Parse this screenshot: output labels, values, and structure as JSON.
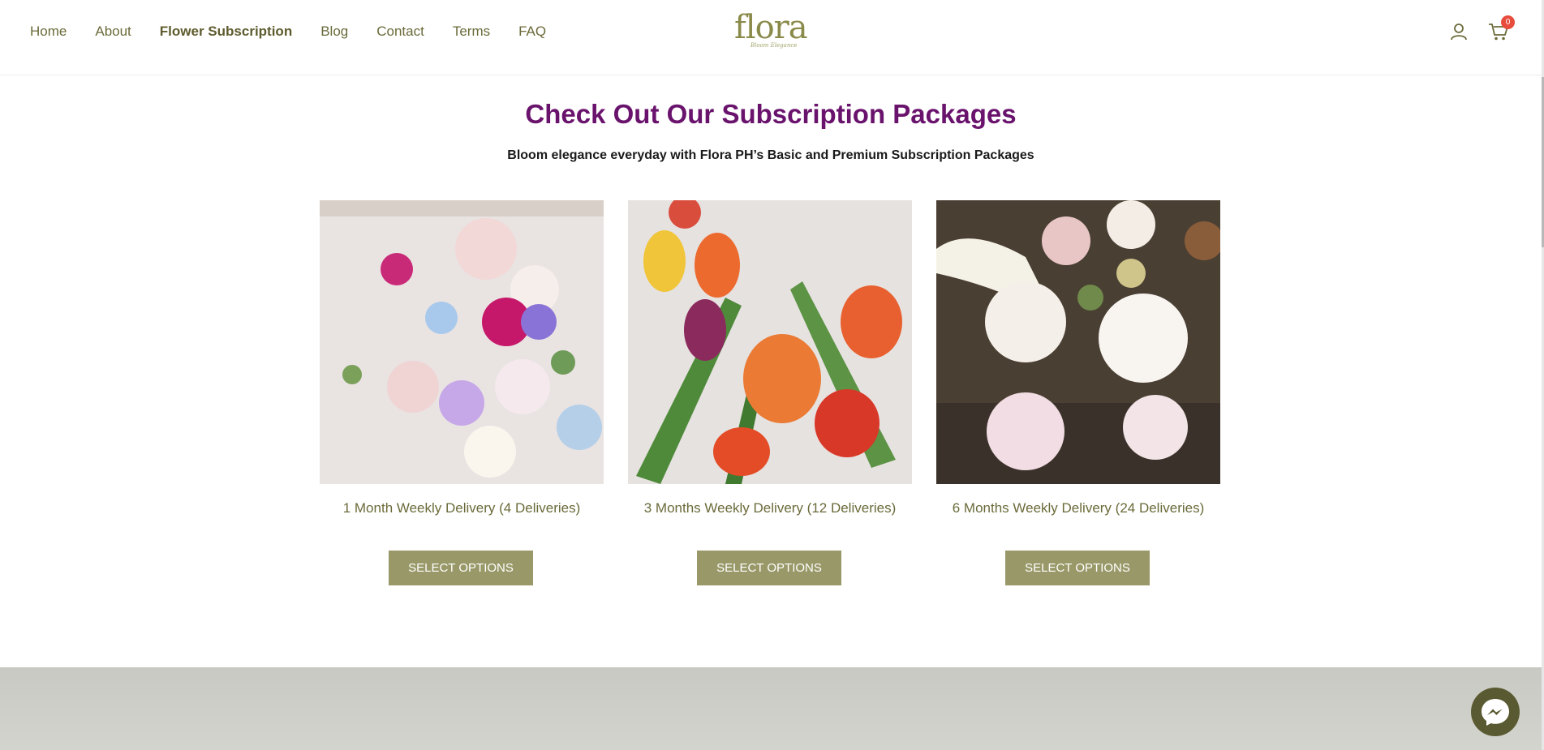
{
  "nav": {
    "items": [
      {
        "label": "Home"
      },
      {
        "label": "About"
      },
      {
        "label": "Flower Subscription"
      },
      {
        "label": "Blog"
      },
      {
        "label": "Contact"
      },
      {
        "label": "Terms"
      },
      {
        "label": "FAQ"
      }
    ]
  },
  "logo": {
    "text": "flora",
    "tagline": "Bloom Elegance"
  },
  "header_icons": {
    "user": "user-icon",
    "cart": "cart-icon",
    "cart_count": "0"
  },
  "section": {
    "title": "Check Out Our Subscription Packages",
    "subtitle": "Bloom elegance everyday with Flora PH’s Basic and Premium Subscription Packages"
  },
  "packages": [
    {
      "title": "1 Month Weekly Delivery (4 Deliveries)",
      "button": "SELECT OPTIONS"
    },
    {
      "title": "3 Months Weekly Delivery (12 Deliveries)",
      "button": "SELECT OPTIONS"
    },
    {
      "title": "6 Months Weekly Delivery (24 Deliveries)",
      "button": "SELECT OPTIONS"
    }
  ],
  "colors": {
    "accent": "#999868",
    "title": "#6a136d",
    "nav_text": "#6b6a3a",
    "badge": "#e74c3c",
    "messenger": "#5a5a32"
  },
  "chat": {
    "icon": "messenger-icon"
  }
}
